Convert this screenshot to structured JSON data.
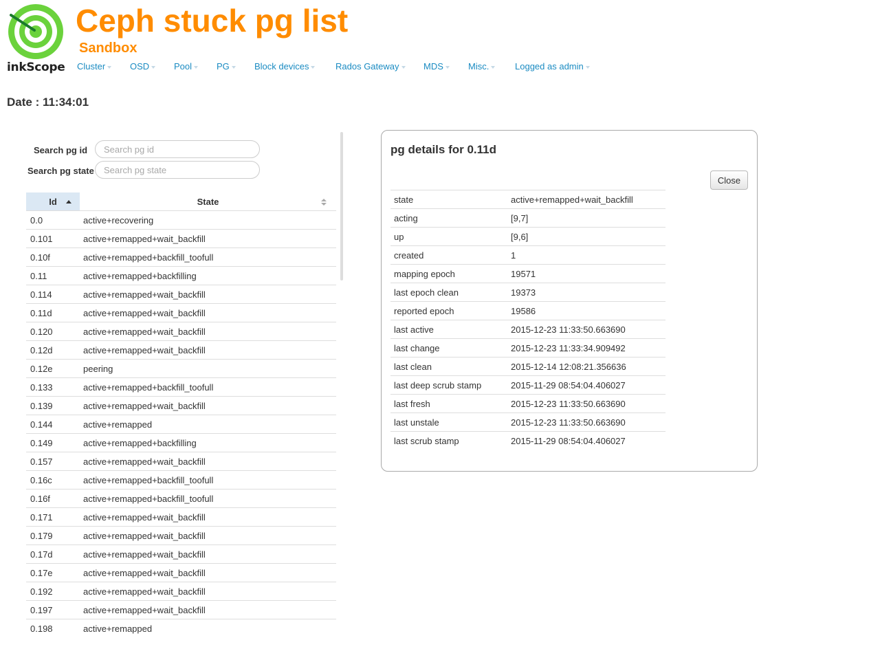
{
  "header": {
    "logo_text": "inkScope",
    "title": "Ceph stuck pg list",
    "subtitle": "Sandbox"
  },
  "nav": [
    "Cluster",
    "OSD",
    "Pool",
    "PG",
    "Block devices",
    "Rados Gateway",
    "MDS",
    "Misc.",
    "Logged as admin"
  ],
  "date_label": "Date : 11:34:01",
  "search": {
    "pgid_label": "Search pg id",
    "pgid_placeholder": "Search pg id",
    "state_label": "Search pg state",
    "state_placeholder": "Search pg state"
  },
  "table": {
    "headers": {
      "id": "Id",
      "state": "State"
    },
    "rows": [
      {
        "id": "0.0",
        "state": "active+recovering"
      },
      {
        "id": "0.101",
        "state": "active+remapped+wait_backfill"
      },
      {
        "id": "0.10f",
        "state": "active+remapped+backfill_toofull"
      },
      {
        "id": "0.11",
        "state": "active+remapped+backfilling"
      },
      {
        "id": "0.114",
        "state": "active+remapped+wait_backfill"
      },
      {
        "id": "0.11d",
        "state": "active+remapped+wait_backfill"
      },
      {
        "id": "0.120",
        "state": "active+remapped+wait_backfill"
      },
      {
        "id": "0.12d",
        "state": "active+remapped+wait_backfill"
      },
      {
        "id": "0.12e",
        "state": "peering"
      },
      {
        "id": "0.133",
        "state": "active+remapped+backfill_toofull"
      },
      {
        "id": "0.139",
        "state": "active+remapped+wait_backfill"
      },
      {
        "id": "0.144",
        "state": "active+remapped"
      },
      {
        "id": "0.149",
        "state": "active+remapped+backfilling"
      },
      {
        "id": "0.157",
        "state": "active+remapped+wait_backfill"
      },
      {
        "id": "0.16c",
        "state": "active+remapped+backfill_toofull"
      },
      {
        "id": "0.16f",
        "state": "active+remapped+backfill_toofull"
      },
      {
        "id": "0.171",
        "state": "active+remapped+wait_backfill"
      },
      {
        "id": "0.179",
        "state": "active+remapped+wait_backfill"
      },
      {
        "id": "0.17d",
        "state": "active+remapped+wait_backfill"
      },
      {
        "id": "0.17e",
        "state": "active+remapped+wait_backfill"
      },
      {
        "id": "0.192",
        "state": "active+remapped+wait_backfill"
      },
      {
        "id": "0.197",
        "state": "active+remapped+wait_backfill"
      },
      {
        "id": "0.198",
        "state": "active+remapped"
      }
    ]
  },
  "details": {
    "title": "pg details for 0.11d",
    "close_label": "Close",
    "rows": [
      {
        "key": "state",
        "value": "active+remapped+wait_backfill"
      },
      {
        "key": "acting",
        "value": "[9,7]"
      },
      {
        "key": "up",
        "value": "[9,6]"
      },
      {
        "key": "created",
        "value": "1"
      },
      {
        "key": "mapping epoch",
        "value": "19571"
      },
      {
        "key": "last epoch clean",
        "value": "19373"
      },
      {
        "key": "reported epoch",
        "value": "19586"
      },
      {
        "key": "last active",
        "value": "2015-12-23 11:33:50.663690"
      },
      {
        "key": "last change",
        "value": "2015-12-23 11:33:34.909492"
      },
      {
        "key": "last clean",
        "value": "2015-12-14 12:08:21.356636"
      },
      {
        "key": "last deep scrub stamp",
        "value": "2015-11-29 08:54:04.406027"
      },
      {
        "key": "last fresh",
        "value": "2015-12-23 11:33:50.663690"
      },
      {
        "key": "last unstale",
        "value": "2015-12-23 11:33:50.663690"
      },
      {
        "key": "last scrub stamp",
        "value": "2015-11-29 08:54:04.406027"
      }
    ]
  },
  "colors": {
    "title": "#ff8c00",
    "link": "#1a8bc2",
    "logo_green": "#6bd23c",
    "sorted_header_bg": "#dbe8f4"
  }
}
